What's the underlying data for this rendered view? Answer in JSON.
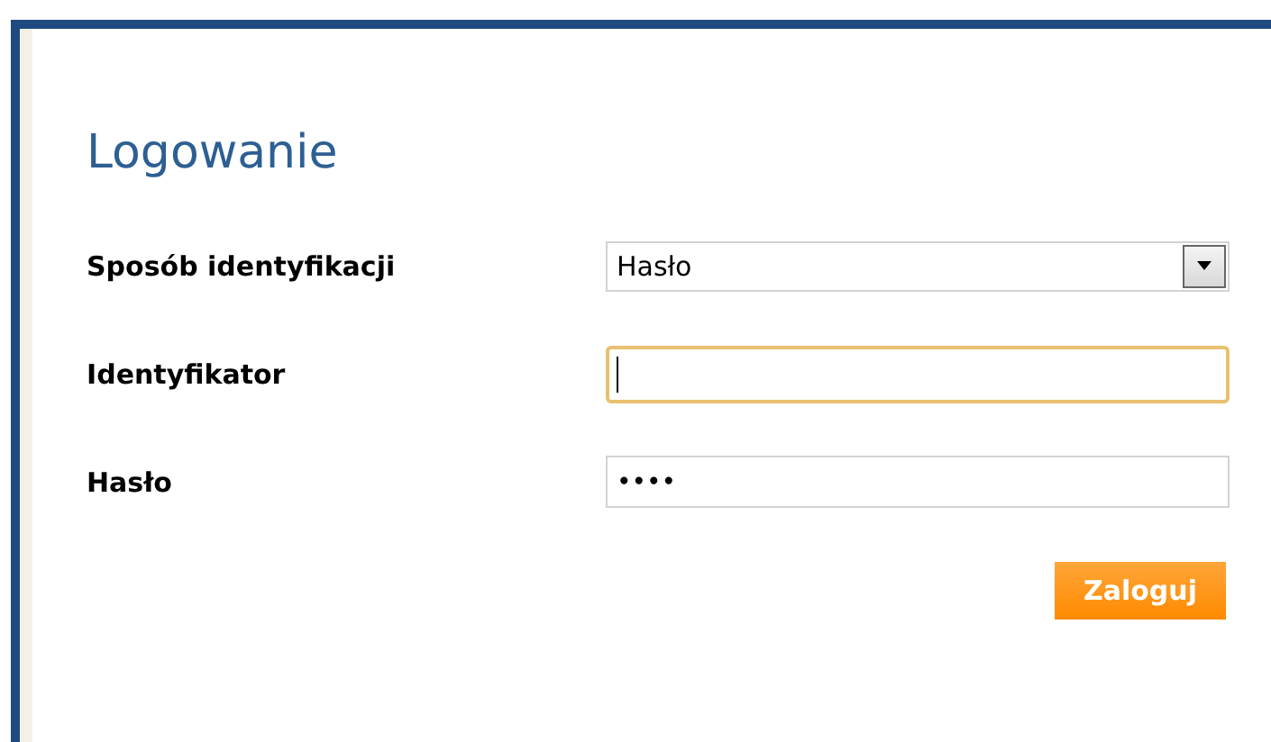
{
  "title": "Logowanie",
  "fields": [
    {
      "kind": "select",
      "label": "Sposób identyfikacji",
      "value": "Hasło",
      "focused": false
    },
    {
      "kind": "text",
      "label": "Identyfikator",
      "focused": true
    },
    {
      "kind": "password",
      "label": "Hasło",
      "value": "••••",
      "focused": false
    }
  ],
  "button": "Zaloguj"
}
